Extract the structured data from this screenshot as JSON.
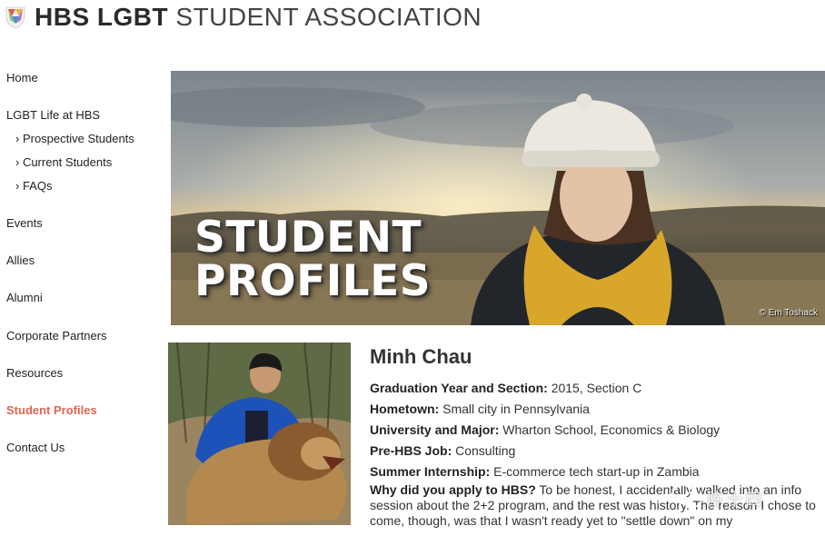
{
  "header": {
    "title_bold": "HBS LGBT",
    "title_light": "STUDENT ASSOCIATION",
    "logo_icon": "shield-logo-icon"
  },
  "sidebar": {
    "items": [
      {
        "label": "Home"
      },
      {
        "label": "LGBT Life at HBS"
      },
      {
        "label": "› Prospective Students"
      },
      {
        "label": "› Current Students"
      },
      {
        "label": "› FAQs"
      },
      {
        "label": "Events"
      },
      {
        "label": "Allies"
      },
      {
        "label": "Alumni"
      },
      {
        "label": "Corporate Partners"
      },
      {
        "label": "Resources"
      },
      {
        "label": "Student Profiles"
      },
      {
        "label": "Contact Us"
      }
    ],
    "active_color": "#e0654f"
  },
  "hero": {
    "title_line1": "STUDENT",
    "title_line2": "PROFILES",
    "credit": "© Em Toshack"
  },
  "profile": {
    "name": "Minh Chau",
    "fields": [
      {
        "label": "Graduation Year and Section:",
        "value": "2015, Section C"
      },
      {
        "label": "Hometown:",
        "value": "Small city in Pennsylvania"
      },
      {
        "label": "University and Major:",
        "value": "Wharton School, Economics & Biology"
      },
      {
        "label": "Pre-HBS Job:",
        "value": "Consulting"
      },
      {
        "label": "Summer Internship:",
        "value": "E-commerce tech start-up in Zambia"
      },
      {
        "label": "Why did you apply to HBS?",
        "value": "To be honest, I accidentally walked into an info session about the 2+2 program, and the rest was history. The reason I chose to come, though, was that I wasn't ready yet to \"settle down\" on my"
      }
    ]
  },
  "watermark": {
    "text": "陈十四"
  }
}
